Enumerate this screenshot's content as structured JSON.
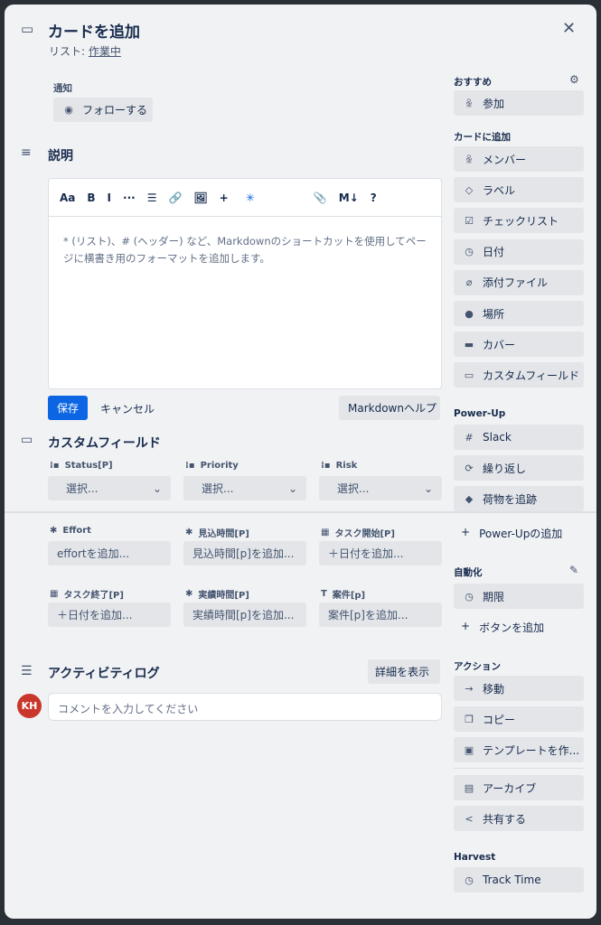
{
  "header": {
    "title": "カードを追加",
    "list_prefix": "リスト: ",
    "list_name": "作業中"
  },
  "notifications": {
    "label": "通知",
    "follow": "フォローする"
  },
  "description": {
    "title": "説明",
    "placeholder": "* (リスト)、# (ヘッダー) など、Markdownのショートカットを使用してページに横書き用のフォーマットを追加します。",
    "save": "保存",
    "cancel": "キャンセル",
    "markdown_help": "Markdownヘルプ",
    "toolbar": [
      "Aa",
      "B",
      "I",
      "···",
      "☰",
      "🔗",
      "🖼",
      "+",
      "✳",
      "📎",
      "M↓",
      "?"
    ]
  },
  "custom_fields": {
    "title": "カスタムフィールド",
    "fields": [
      {
        "label": "Status[P]",
        "value": "選択...",
        "icon": "list-icon",
        "type": "select"
      },
      {
        "label": "Priority",
        "value": "選択...",
        "icon": "list-icon",
        "type": "select"
      },
      {
        "label": "Risk",
        "value": "選択...",
        "icon": "list-icon",
        "type": "select"
      },
      {
        "label": "Effort",
        "value": "effortを追加...",
        "icon": "number-icon"
      },
      {
        "label": "見込時間[P]",
        "value": "見込時間[p]を追加...",
        "icon": "number-icon"
      },
      {
        "label": "タスク開始[P]",
        "value": "＋日付を追加...",
        "icon": "calendar-icon"
      },
      {
        "label": "タスク終了[P]",
        "value": "＋日付を追加...",
        "icon": "calendar-icon"
      },
      {
        "label": "実績時間[P]",
        "value": "実績時間[p]を追加...",
        "icon": "number-icon"
      },
      {
        "label": "案件[p]",
        "value": "案件[p]を追加...",
        "icon": "text-icon"
      }
    ]
  },
  "activity": {
    "title": "アクティビティログ",
    "show_details": "詳細を表示",
    "avatar": "KH",
    "avatar_color": "#c9372c",
    "comment_placeholder": "コメントを入力してください"
  },
  "sidebar": {
    "suggested": {
      "title": "おすすめ",
      "items": [
        {
          "label": "参加",
          "icon": "person-icon"
        }
      ]
    },
    "add_to_card": {
      "title": "カードに追加",
      "items": [
        {
          "label": "メンバー",
          "icon": "person-icon"
        },
        {
          "label": "ラベル",
          "icon": "tag-icon"
        },
        {
          "label": "チェックリスト",
          "icon": "checkbox-icon"
        },
        {
          "label": "日付",
          "icon": "clock-icon"
        },
        {
          "label": "添付ファイル",
          "icon": "paperclip-icon"
        },
        {
          "label": "場所",
          "icon": "location-icon"
        },
        {
          "label": "カバー",
          "icon": "cover-icon"
        },
        {
          "label": "カスタムフィールド",
          "icon": "custom-field-icon"
        }
      ]
    },
    "powerups": {
      "title": "Power-Up",
      "items": [
        {
          "label": "Slack",
          "icon": "slack-icon"
        },
        {
          "label": "繰り返し",
          "icon": "repeat-icon"
        },
        {
          "label": "荷物を追跡",
          "icon": "package-icon"
        }
      ],
      "add": "Power-Upの追加"
    },
    "automation": {
      "title": "自動化",
      "items": [
        {
          "label": "期限",
          "icon": "clock-icon"
        }
      ],
      "add": "ボタンを追加"
    },
    "actions": {
      "title": "アクション",
      "items": [
        {
          "label": "移動",
          "icon": "arrow-right-icon"
        },
        {
          "label": "コピー",
          "icon": "copy-icon"
        },
        {
          "label": "テンプレートを作...",
          "icon": "template-icon"
        },
        {
          "label": "アーカイブ",
          "icon": "archive-icon"
        },
        {
          "label": "共有する",
          "icon": "share-icon"
        }
      ]
    },
    "harvest": {
      "title": "Harvest",
      "items": [
        {
          "label": "Track Time",
          "icon": "clock-icon"
        }
      ]
    }
  },
  "colors": {
    "primary": "#0c66e4",
    "background": "#f1f2f4",
    "button": "#e3e5e8"
  }
}
